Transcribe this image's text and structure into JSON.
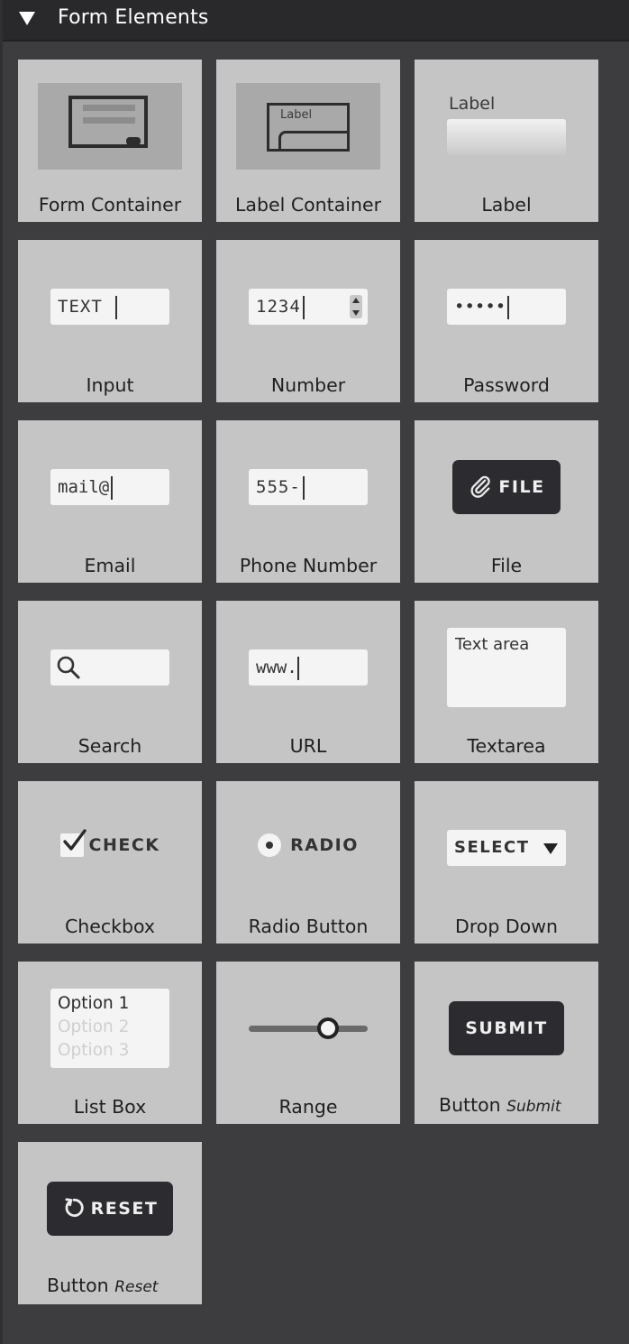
{
  "panel": {
    "title": "Form Elements"
  },
  "tiles": {
    "form_container": {
      "name": "Form Container"
    },
    "label_container": {
      "name": "Label Container",
      "preview": "Label"
    },
    "label": {
      "name": "Label",
      "preview": "Label"
    },
    "input": {
      "name": "Input",
      "preview": "TEXT"
    },
    "number": {
      "name": "Number",
      "preview": "1234"
    },
    "password": {
      "name": "Password",
      "preview": "•••••"
    },
    "email": {
      "name": "Email",
      "preview": "mail@"
    },
    "phone": {
      "name": "Phone Number",
      "preview": "555-"
    },
    "file": {
      "name": "File",
      "preview": "FILE"
    },
    "search": {
      "name": "Search"
    },
    "url": {
      "name": "URL",
      "preview": "www."
    },
    "textarea": {
      "name": "Textarea",
      "preview": "Text area"
    },
    "checkbox": {
      "name": "Checkbox",
      "preview": "CHECK"
    },
    "radio": {
      "name": "Radio Button",
      "preview": "RADIO"
    },
    "dropdown": {
      "name": "Drop Down",
      "preview": "SELECT"
    },
    "listbox": {
      "name": "List Box",
      "options": [
        "Option 1",
        "Option 2",
        "Option 3"
      ]
    },
    "range": {
      "name": "Range",
      "value_fraction": 0.67
    },
    "submit": {
      "name": "Button",
      "variant": "Submit",
      "preview": "SUBMIT"
    },
    "reset": {
      "name": "Button",
      "variant": "Reset",
      "preview": "RESET"
    }
  },
  "colors": {
    "panel_bg": "#3d3d40",
    "header_bg": "#29292c",
    "tile_bg": "#c5c5c5",
    "dark_button": "#2b2b30",
    "field_bg": "#f4f4f4"
  }
}
